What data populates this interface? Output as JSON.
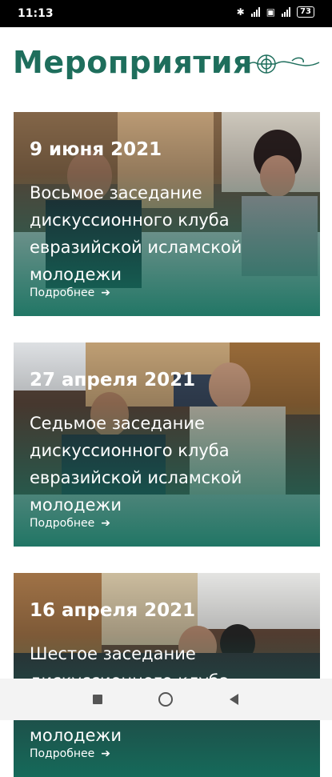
{
  "status_bar": {
    "time": "11:13",
    "battery": "73"
  },
  "page": {
    "heading": "Мероприятия",
    "accent_color": "#1e6e5c"
  },
  "events": [
    {
      "date": "9 июня 2021",
      "title": "Восьмое заседание дискуссионного клуба евразийской исламской молодежи",
      "more_label": "Подробнее"
    },
    {
      "date": "27 апреля 2021",
      "title": "Седьмое заседание дискуссионного клуба евразийской исламской молодежи",
      "more_label": "Подробнее"
    },
    {
      "date": "16 апреля 2021",
      "title": "Шестое заседание дискуссионного клуба евразийской исламской молодежи",
      "more_label": "Подробнее"
    }
  ],
  "nav_bar": {
    "icons": [
      "recents-square-icon",
      "home-circle-icon",
      "back-triangle-icon"
    ]
  }
}
